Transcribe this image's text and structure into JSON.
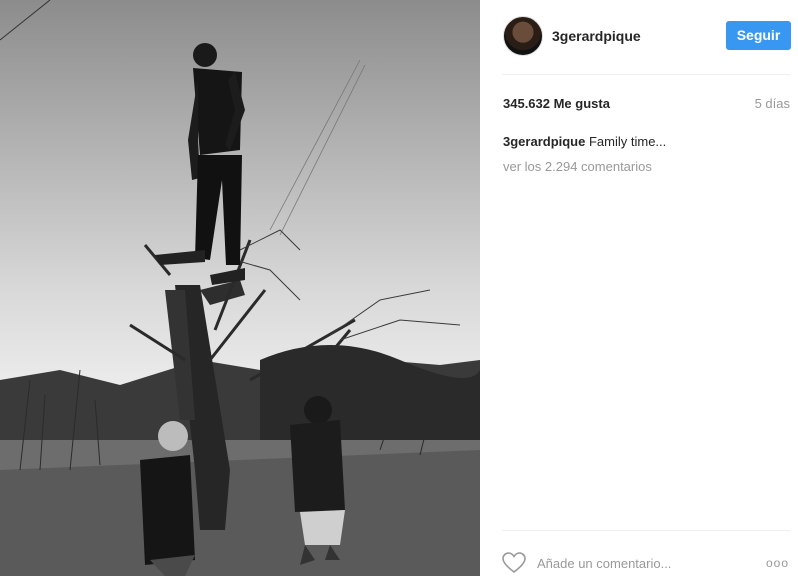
{
  "photo": {
    "description_icon": "family-photo"
  },
  "header": {
    "username": "3gerardpique",
    "follow_label": "Seguir"
  },
  "stats": {
    "likes": "345.632 Me gusta",
    "time": "5 días"
  },
  "caption": {
    "username": "3gerardpique",
    "text": "Family time..."
  },
  "comments": {
    "view_all": "ver los 2.294 comentarios",
    "add_placeholder": "Añade un comentario..."
  },
  "actions": {
    "more": "ooo"
  },
  "colors": {
    "accent": "#3897f0",
    "muted": "#999999"
  }
}
